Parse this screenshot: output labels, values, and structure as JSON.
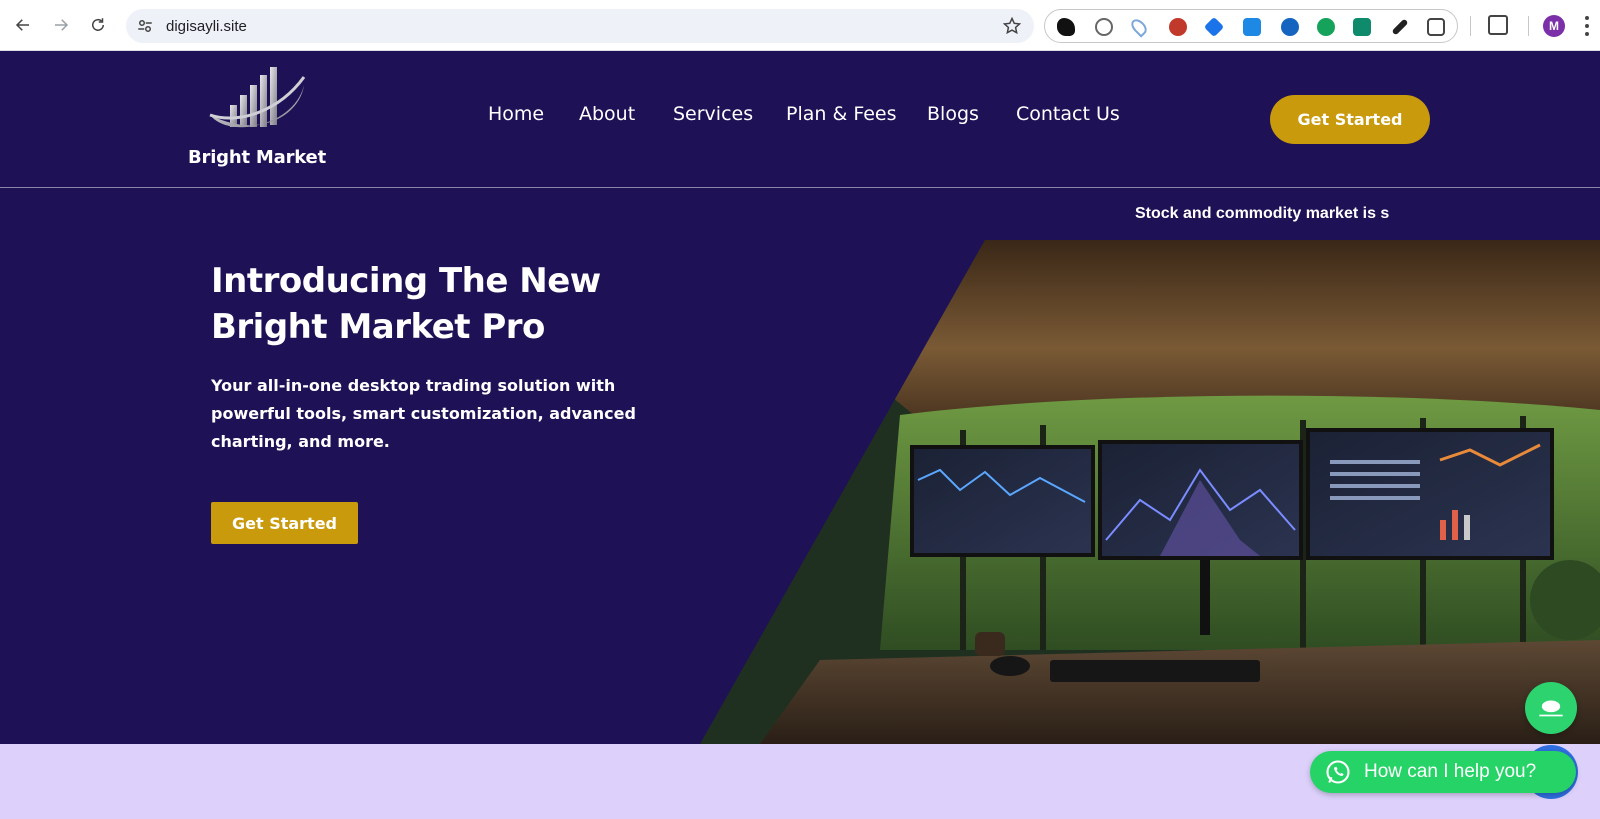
{
  "browser": {
    "url": "digisayli.site",
    "avatar_letter": "M",
    "extensions": [
      "ninja-cat-extension-icon",
      "wordpress-extension-icon",
      "location-extension-icon",
      "seo-extension-icon",
      "tag-extension-icon",
      "download-extension-icon",
      "link-extension-icon",
      "grammarly-extension-icon",
      "ai-extension-icon",
      "eyedropper-extension-icon",
      "puzzle-extensions-icon"
    ]
  },
  "site": {
    "brand": "Bright Market",
    "nav": [
      {
        "label": "Home"
      },
      {
        "label": "About"
      },
      {
        "label": "Services"
      },
      {
        "label": "Plan & Fees"
      },
      {
        "label": "Blogs"
      },
      {
        "label": "Contact Us"
      }
    ],
    "header_cta": "Get Started"
  },
  "hero": {
    "ticker": "Stock and commodity market is s",
    "title": "Introducing The New Bright Market Pro",
    "subtitle": "Your all-in-one desktop trading solution with powerful tools, smart customization, advanced charting, and more.",
    "cta": "Get Started"
  },
  "widgets": {
    "whatsapp_label": "How can I help you?"
  },
  "colors": {
    "header_bg": "#1f1155",
    "accent_gold": "#c99a0c",
    "lower_band": "#ddd1fb",
    "whatsapp_green": "#25d366"
  }
}
